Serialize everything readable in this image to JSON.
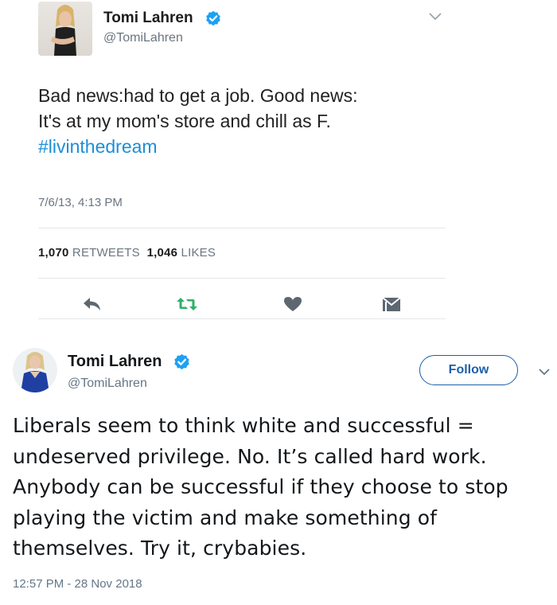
{
  "tweet1": {
    "display_name": "Tomi Lahren",
    "handle": "@TomiLahren",
    "text_line1": "Bad news:had to get a job. Good news:",
    "text_line2": "It's at my mom's store and chill as F.",
    "hashtag": "#livinthedream",
    "timestamp": "7/6/13, 4:13 PM",
    "retweets_count": "1,070",
    "retweets_label": "RETWEETS",
    "likes_count": "1,046",
    "likes_label": "LIKES",
    "actions": [
      "reply-icon",
      "retweet-icon",
      "like-icon",
      "message-icon"
    ],
    "colors": {
      "hashtag": "#1c8fd6",
      "retweet": "#2fb06b",
      "verified": "#1da1f2"
    }
  },
  "tweet2": {
    "display_name": "Tomi Lahren",
    "handle": "@TomiLahren",
    "follow_label": "Follow",
    "text": "Liberals seem to think white and successful = undeserved privilege. No. It’s called hard work. Anybody can be successful if they choose to stop playing the victim and make something of themselves. Try it, crybabies.",
    "timestamp": "12:57 PM - 28 Nov 2018",
    "colors": {
      "follow": "#1d5fa8",
      "verified": "#1da1f2"
    }
  }
}
